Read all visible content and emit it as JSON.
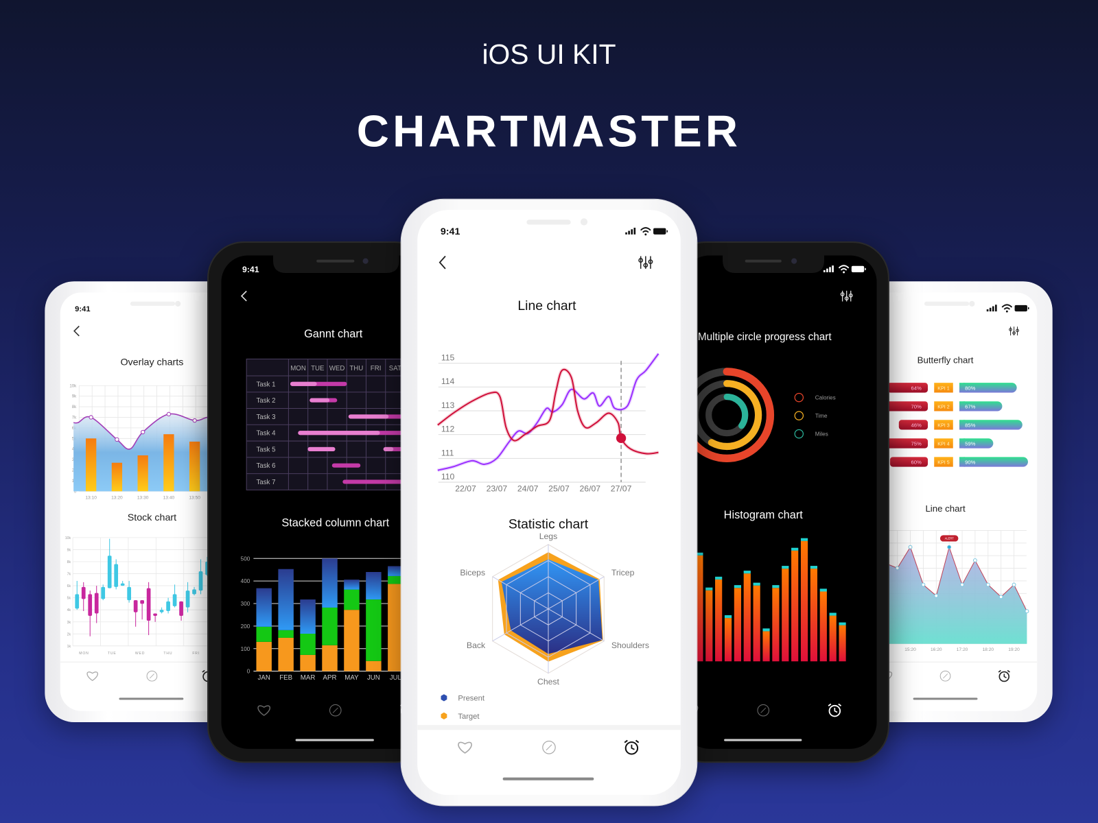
{
  "header": {
    "kicker": "iOS UI KIT",
    "title": "CHARTMASTER"
  },
  "status": {
    "time": "9:41"
  },
  "tab_bar": {
    "icons": [
      "heart-icon",
      "compass-icon",
      "alarm-icon"
    ],
    "active": "alarm-icon"
  },
  "toolbar": {
    "back_icon": "chevron-left-icon",
    "filter_icon": "sliders-icon"
  },
  "colors": {
    "background_top": "#10152f",
    "background_bottom": "#2a3799",
    "cyan": "#3fc8e4",
    "magenta": "#c8279e",
    "orange": "#f7981d",
    "green": "#14c814",
    "blue": "#2f8ef0",
    "red_line": "#d0103a",
    "purple_line": "#9b30ff",
    "calories": "#e8452a",
    "time": "#f6b023",
    "miles": "#2bb39a"
  },
  "chart_data": [
    {
      "type": "bar+line",
      "title": "Overlay charts",
      "categories": [
        "13:10",
        "13:20",
        "13:30",
        "13:40",
        "13:50"
      ],
      "yticks": [
        "0",
        "1k",
        "2k",
        "3k",
        "4k",
        "5k",
        "6k",
        "7k",
        "8k",
        "9k",
        "10k"
      ],
      "ylim": [
        0,
        10000
      ],
      "bars": [
        5000,
        2700,
        3400,
        5400,
        4700
      ],
      "line": [
        {
          "x": "13:05",
          "y": 6500
        },
        {
          "x": "13:10",
          "y": 7000,
          "marker": true
        },
        {
          "x": "13:20",
          "y": 4900,
          "marker": true
        },
        {
          "x": "13:25",
          "y": 4000
        },
        {
          "x": "13:30",
          "y": 5600,
          "marker": true
        },
        {
          "x": "13:40",
          "y": 7300,
          "marker": true
        },
        {
          "x": "13:50",
          "y": 6700,
          "marker": true
        },
        {
          "x": "13:55",
          "y": 7000
        }
      ]
    },
    {
      "type": "candlestick",
      "title": "Stock chart",
      "categories": [
        "MON",
        "TUE",
        "WED",
        "THU",
        "FRI"
      ],
      "yticks": [
        "1k",
        "2k",
        "3k",
        "4k",
        "5k",
        "6k",
        "7k",
        "8k",
        "9k",
        "10k"
      ],
      "ylim": [
        1000,
        10000
      ],
      "candles_lohc": [
        [
          4000,
          4100,
          5300,
          6400
        ],
        [
          3900,
          5900,
          4900,
          6300
        ],
        [
          1800,
          5300,
          3500,
          5600
        ],
        [
          2900,
          5400,
          3700,
          6000
        ],
        [
          4800,
          4900,
          5900,
          6100
        ],
        [
          5800,
          5800,
          8500,
          9900
        ],
        [
          5700,
          5900,
          7800,
          8200
        ],
        [
          6000,
          6000,
          6200,
          6400
        ],
        [
          4600,
          4800,
          5900,
          6400
        ],
        [
          2600,
          4800,
          3800,
          4800
        ],
        [
          3200,
          4800,
          4500,
          4800
        ],
        [
          1900,
          5800,
          3100,
          6300
        ],
        [
          3000,
          3700,
          3500,
          3700
        ],
        [
          3700,
          3800,
          4000,
          4200
        ],
        [
          3700,
          3900,
          4700,
          5000
        ],
        [
          4200,
          4300,
          5300,
          6100
        ],
        [
          3100,
          4700,
          3500,
          4700
        ],
        [
          3800,
          4200,
          5600,
          6300
        ],
        [
          5200,
          5300,
          5700,
          5900
        ],
        [
          5300,
          5600,
          7200,
          8200
        ],
        [
          6800,
          6900,
          8000,
          8400
        ]
      ]
    },
    {
      "type": "gantt",
      "title": "Gannt chart",
      "days": [
        "MON",
        "TUE",
        "WED",
        "THU",
        "FRI",
        "SAT"
      ],
      "tasks": [
        {
          "name": "Task 1",
          "bars": [
            {
              "start": 0.2,
              "end": 2.9,
              "done": 1.35
            }
          ]
        },
        {
          "name": "Task 2",
          "bars": [
            {
              "start": 1.2,
              "end": 2.4,
              "done": 2.0
            }
          ]
        },
        {
          "name": "Task 3",
          "bars": [
            {
              "start": 3.2,
              "end": 6.0,
              "done": 5.05
            }
          ]
        },
        {
          "name": "Task 4",
          "bars": [
            {
              "start": 0.6,
              "end": 6.0,
              "done": 4.6
            }
          ]
        },
        {
          "name": "Task 5",
          "bars": [
            {
              "start": 1.1,
              "end": 2.3,
              "done": 2.3
            },
            {
              "start": 5.0,
              "end": 6.0,
              "done": 5.3
            }
          ]
        },
        {
          "name": "Task 6",
          "bars": [
            {
              "start": 2.35,
              "end": 3.6,
              "done": 2.35
            }
          ]
        },
        {
          "name": "Task 7",
          "bars": [
            {
              "start": 2.9,
              "end": 6.0,
              "done": 2.9
            }
          ]
        }
      ]
    },
    {
      "type": "stacked-bar",
      "title": "Stacked column chart",
      "categories": [
        "JAN",
        "FEB",
        "MAR",
        "APR",
        "MAY",
        "JUN",
        "JUL"
      ],
      "yticks": [
        "0",
        "100",
        "200",
        "300",
        "400",
        "500"
      ],
      "ylim": [
        0,
        500
      ],
      "series": [
        {
          "color": "#f7981d",
          "values": [
            130,
            148,
            72,
            115,
            272,
            45,
            387
          ]
        },
        {
          "color": "#14c814",
          "values": [
            67,
            34,
            94,
            167,
            90,
            273,
            35
          ]
        },
        {
          "color": "#2f8ef0",
          "values": [
            171,
            271,
            152,
            218,
            44,
            122,
            44
          ]
        }
      ]
    },
    {
      "type": "line",
      "title": "Line chart",
      "xticks": [
        "22/07",
        "23/07",
        "24/07",
        "25/07",
        "26/07",
        "27/07"
      ],
      "yticks": [
        "110",
        "111",
        "112",
        "113",
        "114",
        "115"
      ],
      "ylim": [
        110,
        115
      ],
      "x_unit": "day of July",
      "series": [
        {
          "color": "#d0103a",
          "points": [
            [
              21.1,
              112.4
            ],
            [
              21.6,
              112.9
            ],
            [
              22.2,
              113.4
            ],
            [
              22.8,
              113.75
            ],
            [
              23.1,
              113.6
            ],
            [
              23.3,
              112.3
            ],
            [
              23.55,
              111.75
            ],
            [
              23.9,
              112.0
            ],
            [
              24.3,
              112.35
            ],
            [
              24.7,
              112.6
            ],
            [
              24.9,
              113.8
            ],
            [
              25.1,
              114.7
            ],
            [
              25.4,
              114.4
            ],
            [
              25.6,
              113.0
            ],
            [
              25.85,
              112.3
            ],
            [
              26.2,
              112.5
            ],
            [
              26.6,
              112.9
            ],
            [
              26.9,
              112.5
            ],
            [
              27.0,
              111.85
            ],
            [
              27.3,
              111.4
            ],
            [
              27.8,
              111.2
            ],
            [
              28.2,
              111.25
            ]
          ]
        },
        {
          "color": "#9b30ff",
          "points": [
            [
              21.1,
              110.5
            ],
            [
              21.6,
              110.65
            ],
            [
              22.2,
              110.9
            ],
            [
              22.6,
              110.75
            ],
            [
              23.0,
              111.0
            ],
            [
              23.4,
              111.7
            ],
            [
              23.7,
              112.15
            ],
            [
              24.0,
              112.05
            ],
            [
              24.3,
              112.5
            ],
            [
              24.6,
              113.1
            ],
            [
              24.8,
              112.95
            ],
            [
              25.1,
              113.25
            ],
            [
              25.4,
              113.9
            ],
            [
              25.8,
              113.5
            ],
            [
              26.1,
              113.75
            ],
            [
              26.3,
              113.2
            ],
            [
              26.6,
              113.6
            ],
            [
              26.8,
              113.1
            ],
            [
              27.2,
              113.2
            ],
            [
              27.5,
              114.3
            ],
            [
              27.8,
              114.7
            ],
            [
              28.2,
              115.4
            ]
          ]
        }
      ],
      "highlight": {
        "x": 27.0,
        "y": 111.85
      }
    },
    {
      "type": "radar",
      "title": "Statistic chart",
      "axes": [
        "Legs",
        "Tricep",
        "Shoulders",
        "Chest",
        "Back",
        "Biceps"
      ],
      "max": 100,
      "series": [
        {
          "name": "Target",
          "color": "#f7a21d",
          "values": [
            88,
            92,
            98,
            82,
            79,
            90
          ]
        },
        {
          "name": "Present",
          "color": "#2e4fb0",
          "values": [
            77,
            90,
            97,
            70,
            67,
            84
          ]
        }
      ],
      "legend_order": [
        "Present",
        "Target"
      ]
    },
    {
      "type": "radial-progress",
      "title": "Multiple circle progress chart",
      "series": [
        {
          "name": "Calories",
          "color": "#e8452a",
          "percent": 80
        },
        {
          "name": "Time",
          "color": "#f6b023",
          "percent": 58
        },
        {
          "name": "Miles",
          "color": "#2bb39a",
          "percent": 35
        }
      ]
    },
    {
      "type": "histogram",
      "title": "Histogram chart",
      "values": [
        88,
        59,
        68,
        36,
        61,
        73,
        63,
        25,
        61,
        77,
        92,
        100,
        77,
        58,
        38,
        30
      ]
    },
    {
      "type": "butterfly",
      "title": "Butterfly chart",
      "rows": [
        {
          "label": "KPI 1",
          "left": "64%",
          "right": "80%",
          "left_value": 64,
          "right_value": 80
        },
        {
          "label": "KPI 2",
          "left": "70%",
          "right": "67%",
          "left_value": 70,
          "right_value": 67
        },
        {
          "label": "KPI 3",
          "left": "46%",
          "right": "85%",
          "left_value": 46,
          "right_value": 85
        },
        {
          "label": "KPI 4",
          "left": "75%",
          "right": "59%",
          "left_value": 75,
          "right_value": 59
        },
        {
          "label": "KPI 5",
          "left": "60%",
          "right": "90%",
          "left_value": 60,
          "right_value": 90
        }
      ]
    },
    {
      "type": "area",
      "title": "Line chart",
      "xticks": [
        "15:20",
        "16:20",
        "17:20",
        "18:20",
        "19:20"
      ],
      "points": [
        [
          "14:50",
          59
        ],
        [
          "15:20",
          78
        ],
        [
          "15:50",
          44
        ],
        [
          "16:20",
          34
        ],
        [
          "16:50",
          78
        ],
        [
          "17:20",
          44
        ],
        [
          "17:50",
          66
        ],
        [
          "18:20",
          44
        ],
        [
          "18:50",
          33
        ],
        [
          "19:20",
          44
        ],
        [
          "19:50",
          20
        ]
      ],
      "ylim": [
        0,
        100
      ],
      "alert": {
        "index": 4,
        "label": "ALERT"
      }
    }
  ]
}
